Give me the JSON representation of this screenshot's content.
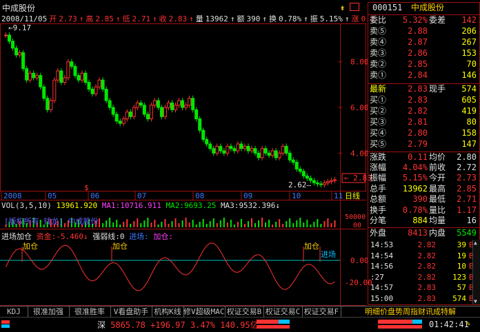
{
  "stock": {
    "name": "中成股份",
    "code": "000151"
  },
  "infobar": {
    "date": "2008/11/05",
    "open_label": "开",
    "open": "2.73",
    "high_label": "高",
    "high": "2.85",
    "low_label": "低",
    "low": "2.71",
    "close_label": "收",
    "close": "2.83",
    "volume_label": "量",
    "volume": "13962",
    "amount_label": "额",
    "amount": "390",
    "turnover_label": "换",
    "turnover": "0.78%",
    "amplitude_label": "振",
    "amplitude": "5.15%",
    "change_label": "涨",
    "change": "0.1"
  },
  "price_chart": {
    "y_ticks": [
      "8.00",
      "6.00",
      "4.00"
    ],
    "y_values": [
      8.0,
      6.0,
      4.0
    ],
    "y_range": [
      2.5,
      9.5
    ],
    "max_label": "9.17",
    "min_label": "2.62",
    "current_label": "2.83",
    "x_ticks": [
      "2008",
      "05",
      "06",
      "07",
      "08",
      "09",
      "10",
      "11"
    ],
    "period_label": "日线",
    "marker": "$",
    "close_values": [
      9.17,
      8.9,
      8.6,
      8.3,
      8.4,
      7.7,
      7.2,
      7.5,
      7.3,
      7.4,
      6.9,
      6.4,
      5.9,
      6.3,
      7.2,
      7.6,
      7.1,
      7.3,
      8.0,
      7.8,
      7.4,
      7.2,
      7.5,
      7.1,
      6.8,
      6.6,
      6.9,
      7.2,
      6.8,
      6.3,
      6.0,
      5.7,
      5.4,
      5.3,
      5.5,
      5.8,
      5.6,
      6.0,
      6.2,
      6.1,
      5.7,
      5.5,
      6.1,
      6.3,
      6.0,
      5.6,
      6.0,
      6.2,
      5.9,
      6.1,
      6.3,
      6.0,
      6.1,
      6.4,
      5.9,
      5.5,
      5.0,
      4.6,
      4.4,
      4.2,
      4.0,
      4.3,
      4.1,
      4.0,
      4.3,
      4.2,
      4.1,
      4.4,
      4.2,
      4.3,
      4.1,
      4.2,
      4.0,
      3.8,
      4.2,
      4.0,
      3.9,
      4.1,
      3.8,
      4.0,
      4.3,
      4.0,
      3.7,
      3.6,
      3.3,
      3.2,
      3.0,
      2.9,
      2.8,
      2.7,
      2.65,
      2.62,
      2.7,
      2.75,
      2.8,
      2.83
    ]
  },
  "volume_chart": {
    "header": "VOL(3,5,10)",
    "vol_value": "13961.920",
    "ma1_label": "MA1:",
    "ma1": "10716.911",
    "ma2_label": "MA2:",
    "ma2": "9693.25",
    "ma3_label": "MA3:",
    "ma3": "9532.396",
    "y_ticks": [
      "50000",
      "00"
    ],
    "title_text": "[版权所有 钱龙] 中成股份"
  },
  "indicator_chart": {
    "header": "进场加仓",
    "fund_label": "资金:",
    "fund": "-5.460",
    "strength_label": "强弱线:",
    "strength": "0",
    "entry_label": "进场:",
    "add_label": "加仓:",
    "y_ticks": [
      "0.00",
      "-20.00"
    ],
    "annotations": [
      "加仓",
      "加仓",
      "加仓",
      "进场"
    ]
  },
  "quote": {
    "header_code": "000151",
    "header_name": "中成股份",
    "weibi_label": "委比",
    "weibi": "5.32%",
    "weicha_label": "委差",
    "weicha": "142",
    "sells": [
      {
        "label": "卖⑤",
        "price": "2.88",
        "vol": "206"
      },
      {
        "label": "卖④",
        "price": "2.87",
        "vol": "267"
      },
      {
        "label": "卖③",
        "price": "2.86",
        "vol": "153"
      },
      {
        "label": "卖②",
        "price": "2.85",
        "vol": "70"
      },
      {
        "label": "卖①",
        "price": "2.84",
        "vol": "146"
      }
    ],
    "latest_label": "最新",
    "latest": "2.83",
    "cur_vol_label": "现手",
    "cur_vol": "574",
    "buys": [
      {
        "label": "买①",
        "price": "2.83",
        "vol": "605"
      },
      {
        "label": "买②",
        "price": "2.82",
        "vol": "419"
      },
      {
        "label": "买③",
        "price": "2.81",
        "vol": "80"
      },
      {
        "label": "买④",
        "price": "2.80",
        "vol": "158"
      },
      {
        "label": "买⑤",
        "price": "2.79",
        "vol": "147"
      }
    ],
    "stats": [
      {
        "l1": "涨跌",
        "v1": "0.11",
        "l2": "均价",
        "v2": "2.80"
      },
      {
        "l1": "涨幅",
        "v1": "4.04%",
        "l2": "前收",
        "v2": "2.72"
      },
      {
        "l1": "振幅",
        "v1": "5.15%",
        "l2": "今开",
        "v2": "2.73"
      },
      {
        "l1": "总手",
        "v1": "13962",
        "l2": "最高",
        "v2": "2.85"
      },
      {
        "l1": "总额",
        "v1": "390",
        "l2": "最低",
        "v2": "2.71"
      },
      {
        "l1": "换手",
        "v1": "0.78%",
        "l2": "量比",
        "v2": "1.17"
      },
      {
        "l1": "分笔",
        "v1": "884",
        "l2": "均量",
        "v2": "16"
      }
    ],
    "outer_label": "外盘",
    "outer": "8413",
    "inner_label": "内盘",
    "inner": "5549",
    "ticks": [
      {
        "time": "14:53",
        "price": "2.82",
        "vol": "39",
        "bs": "B"
      },
      {
        "time": "14:54",
        "price": "2.82",
        "vol": "19",
        "bs": "B"
      },
      {
        "time": "14:56",
        "price": "2.82",
        "vol": "10",
        "bs": "B"
      },
      {
        "time": ":27",
        "price": "2.82",
        "vol": "123",
        "bs": "B"
      },
      {
        "time": "14:57",
        "price": "2.83",
        "vol": "57",
        "bs": "B"
      },
      {
        "time": "15:00",
        "price": "2.83",
        "vol": "574",
        "bs": "B"
      }
    ]
  },
  "tabs": [
    "KDJ",
    "很准加强",
    "很准胜率",
    "V看盘助手",
    "机构K线",
    "修V超级MACD",
    "权证交易B",
    "权证交易C",
    "权证交易F"
  ],
  "right_tabs": [
    "明细",
    "价盘",
    "势周",
    "指财",
    "讯成",
    "特解"
  ],
  "status": {
    "index_name": "深",
    "index_value": "5865.78",
    "index_change": "+196.97",
    "index_pct": "3.47%",
    "index_amount": "140.95亿",
    "time": "01:42:41"
  },
  "colors": {
    "up": "#ff3232",
    "down": "#00e600",
    "frame": "#a01010",
    "ma1": "#ff40ff",
    "ma2": "#00ff00",
    "vol": "#ffff00"
  }
}
